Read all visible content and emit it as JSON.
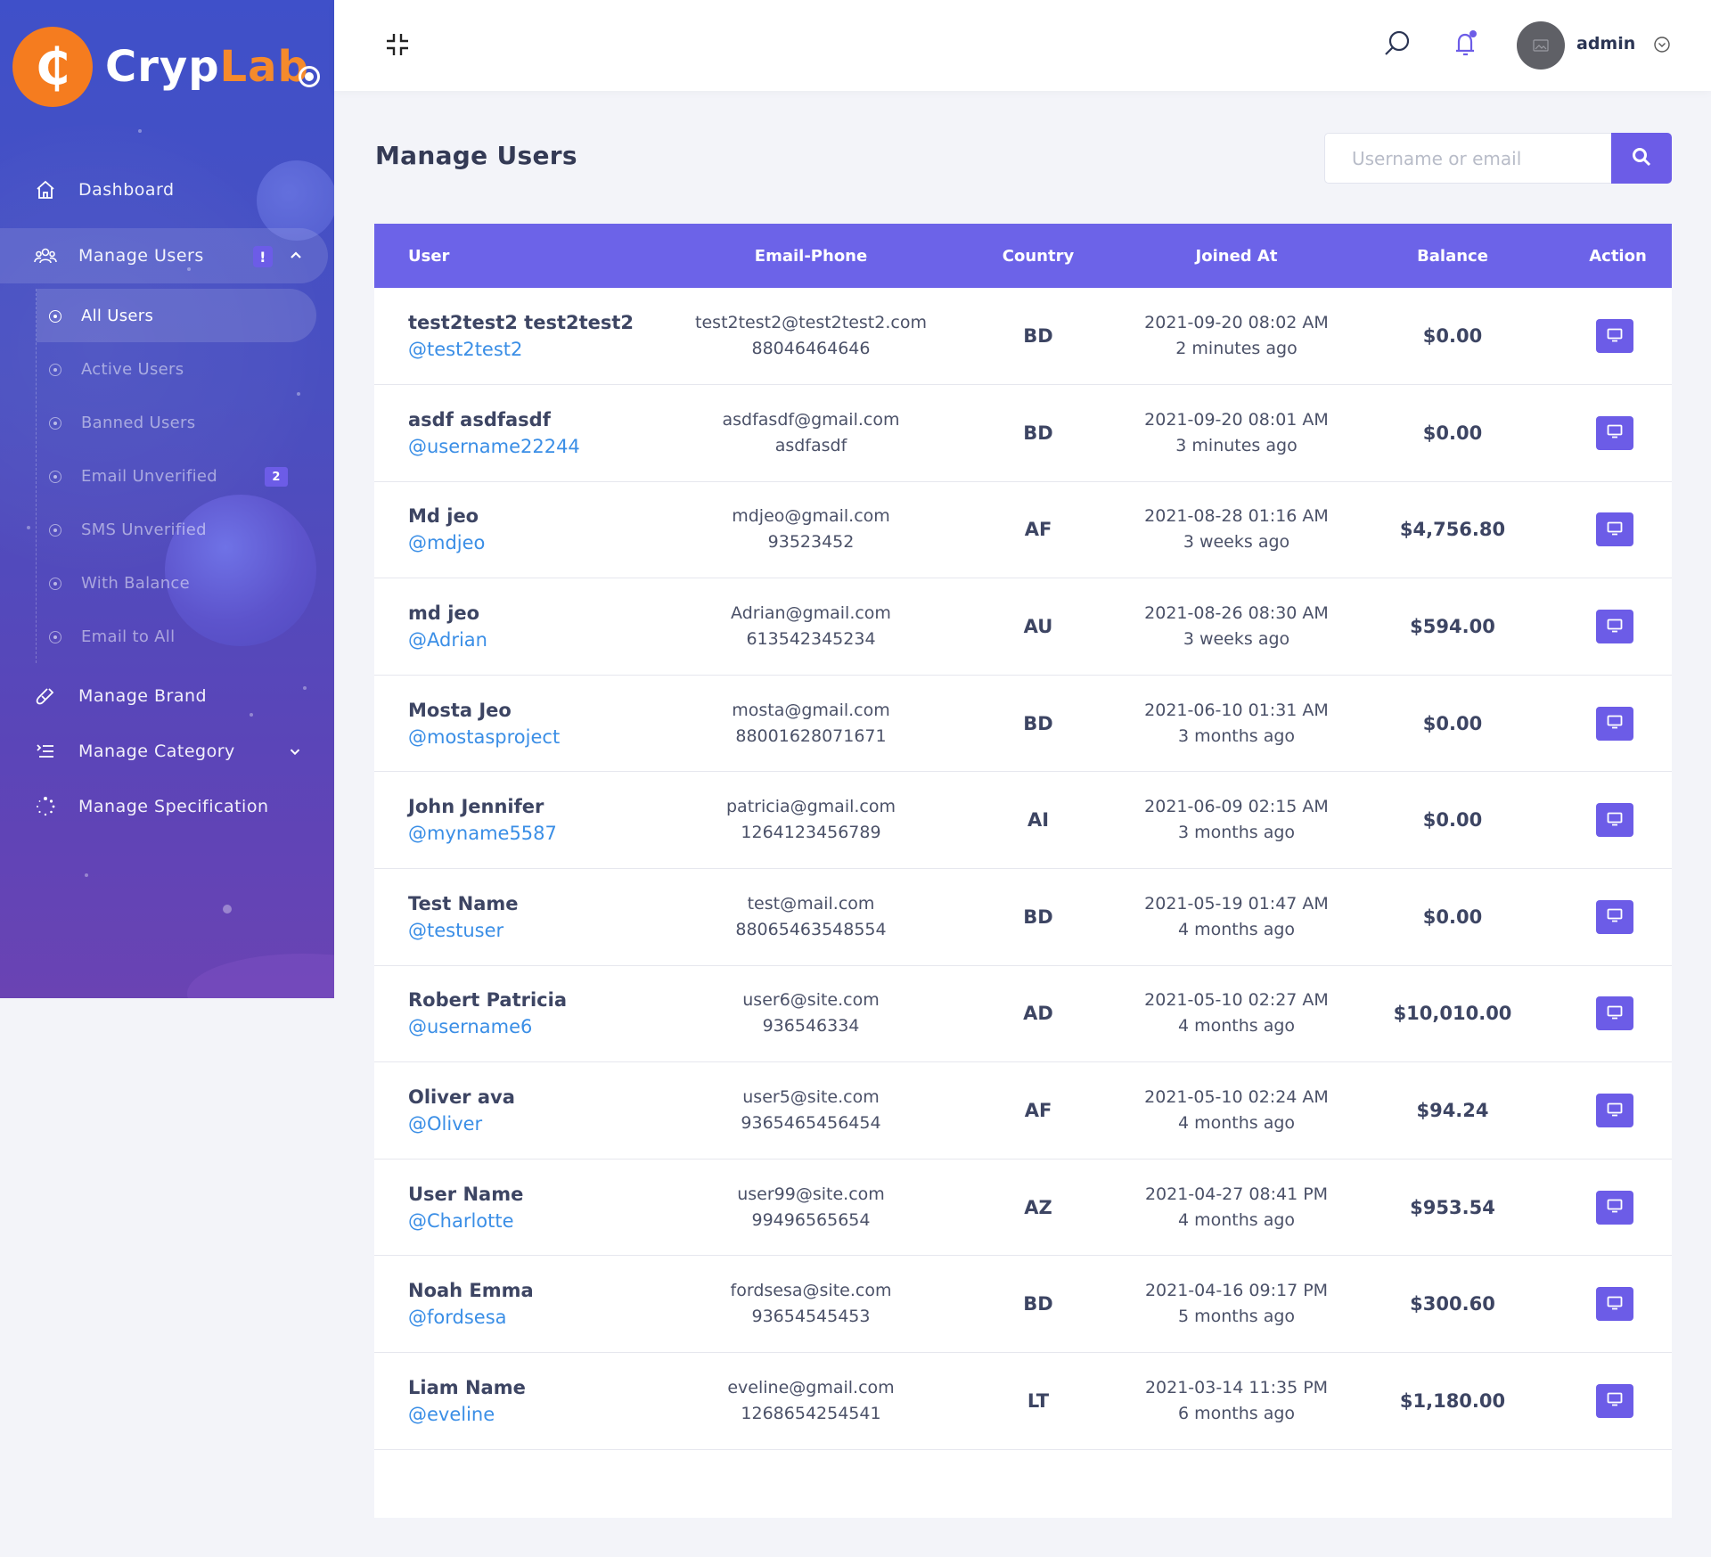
{
  "brand": {
    "part1": "Cryp",
    "part2": "Lab",
    "coin_symbol": "₵"
  },
  "sidebar": {
    "items": [
      {
        "label": "Dashboard",
        "icon": "home-icon"
      },
      {
        "label": "Manage Users",
        "icon": "users-icon",
        "badge": "!"
      },
      {
        "label": "Manage Brand",
        "icon": "brand-icon"
      },
      {
        "label": "Manage Category",
        "icon": "category-icon"
      },
      {
        "label": "Manage Specification",
        "icon": "spinner-icon"
      }
    ],
    "submenu": [
      {
        "label": "All Users",
        "active": true
      },
      {
        "label": "Active Users"
      },
      {
        "label": "Banned Users"
      },
      {
        "label": "Email Unverified",
        "badge": "2"
      },
      {
        "label": "SMS Unverified"
      },
      {
        "label": "With Balance"
      },
      {
        "label": "Email to All"
      }
    ]
  },
  "topbar": {
    "user": "admin"
  },
  "page": {
    "title": "Manage Users",
    "search_placeholder": "Username or email"
  },
  "table": {
    "headers": [
      "User",
      "Email-Phone",
      "Country",
      "Joined At",
      "Balance",
      "Action"
    ],
    "rows": [
      {
        "name": "test2test2 test2test2",
        "handle": "@test2test2",
        "email": "test2test2@test2test2.com",
        "phone": "88046464646",
        "country": "BD",
        "date": "2021-09-20 08:02 AM",
        "ago": "2 minutes ago",
        "balance": "$0.00"
      },
      {
        "name": "asdf asdfasdf",
        "handle": "@username22244",
        "email": "asdfasdf@gmail.com",
        "phone": "asdfasdf",
        "country": "BD",
        "date": "2021-09-20 08:01 AM",
        "ago": "3 minutes ago",
        "balance": "$0.00"
      },
      {
        "name": "Md jeo",
        "handle": "@mdjeo",
        "email": "mdjeo@gmail.com",
        "phone": "93523452",
        "country": "AF",
        "date": "2021-08-28 01:16 AM",
        "ago": "3 weeks ago",
        "balance": "$4,756.80"
      },
      {
        "name": "md jeo",
        "handle": "@Adrian",
        "email": "Adrian@gmail.com",
        "phone": "613542345234",
        "country": "AU",
        "date": "2021-08-26 08:30 AM",
        "ago": "3 weeks ago",
        "balance": "$594.00"
      },
      {
        "name": "Mosta Jeo",
        "handle": "@mostasproject",
        "email": "mosta@gmail.com",
        "phone": "88001628071671",
        "country": "BD",
        "date": "2021-06-10 01:31 AM",
        "ago": "3 months ago",
        "balance": "$0.00"
      },
      {
        "name": "John Jennifer",
        "handle": "@myname5587",
        "email": "patricia@gmail.com",
        "phone": "1264123456789",
        "country": "AI",
        "date": "2021-06-09 02:15 AM",
        "ago": "3 months ago",
        "balance": "$0.00"
      },
      {
        "name": "Test Name",
        "handle": "@testuser",
        "email": "test@mail.com",
        "phone": "88065463548554",
        "country": "BD",
        "date": "2021-05-19 01:47 AM",
        "ago": "4 months ago",
        "balance": "$0.00"
      },
      {
        "name": "Robert Patricia",
        "handle": "@username6",
        "email": "user6@site.com",
        "phone": "936546334",
        "country": "AD",
        "date": "2021-05-10 02:27 AM",
        "ago": "4 months ago",
        "balance": "$10,010.00"
      },
      {
        "name": "Oliver ava",
        "handle": "@Oliver",
        "email": "user5@site.com",
        "phone": "9365465456454",
        "country": "AF",
        "date": "2021-05-10 02:24 AM",
        "ago": "4 months ago",
        "balance": "$94.24"
      },
      {
        "name": "User Name",
        "handle": "@Charlotte",
        "email": "user99@site.com",
        "phone": "99496565654",
        "country": "AZ",
        "date": "2021-04-27 08:41 PM",
        "ago": "4 months ago",
        "balance": "$953.54"
      },
      {
        "name": "Noah Emma",
        "handle": "@fordsesa",
        "email": "fordsesa@site.com",
        "phone": "93654545453",
        "country": "BD",
        "date": "2021-04-16 09:17 PM",
        "ago": "5 months ago",
        "balance": "$300.60"
      },
      {
        "name": "Liam Name",
        "handle": "@eveline",
        "email": "eveline@gmail.com",
        "phone": "1268654254541",
        "country": "LT",
        "date": "2021-03-14 11:35 PM",
        "ago": "6 months ago",
        "balance": "$1,180.00"
      }
    ]
  },
  "colors": {
    "accent": "#6c5ce7",
    "header": "#6c63e8",
    "link": "#3a8ee6",
    "logo_orange": "#f57c1f"
  }
}
